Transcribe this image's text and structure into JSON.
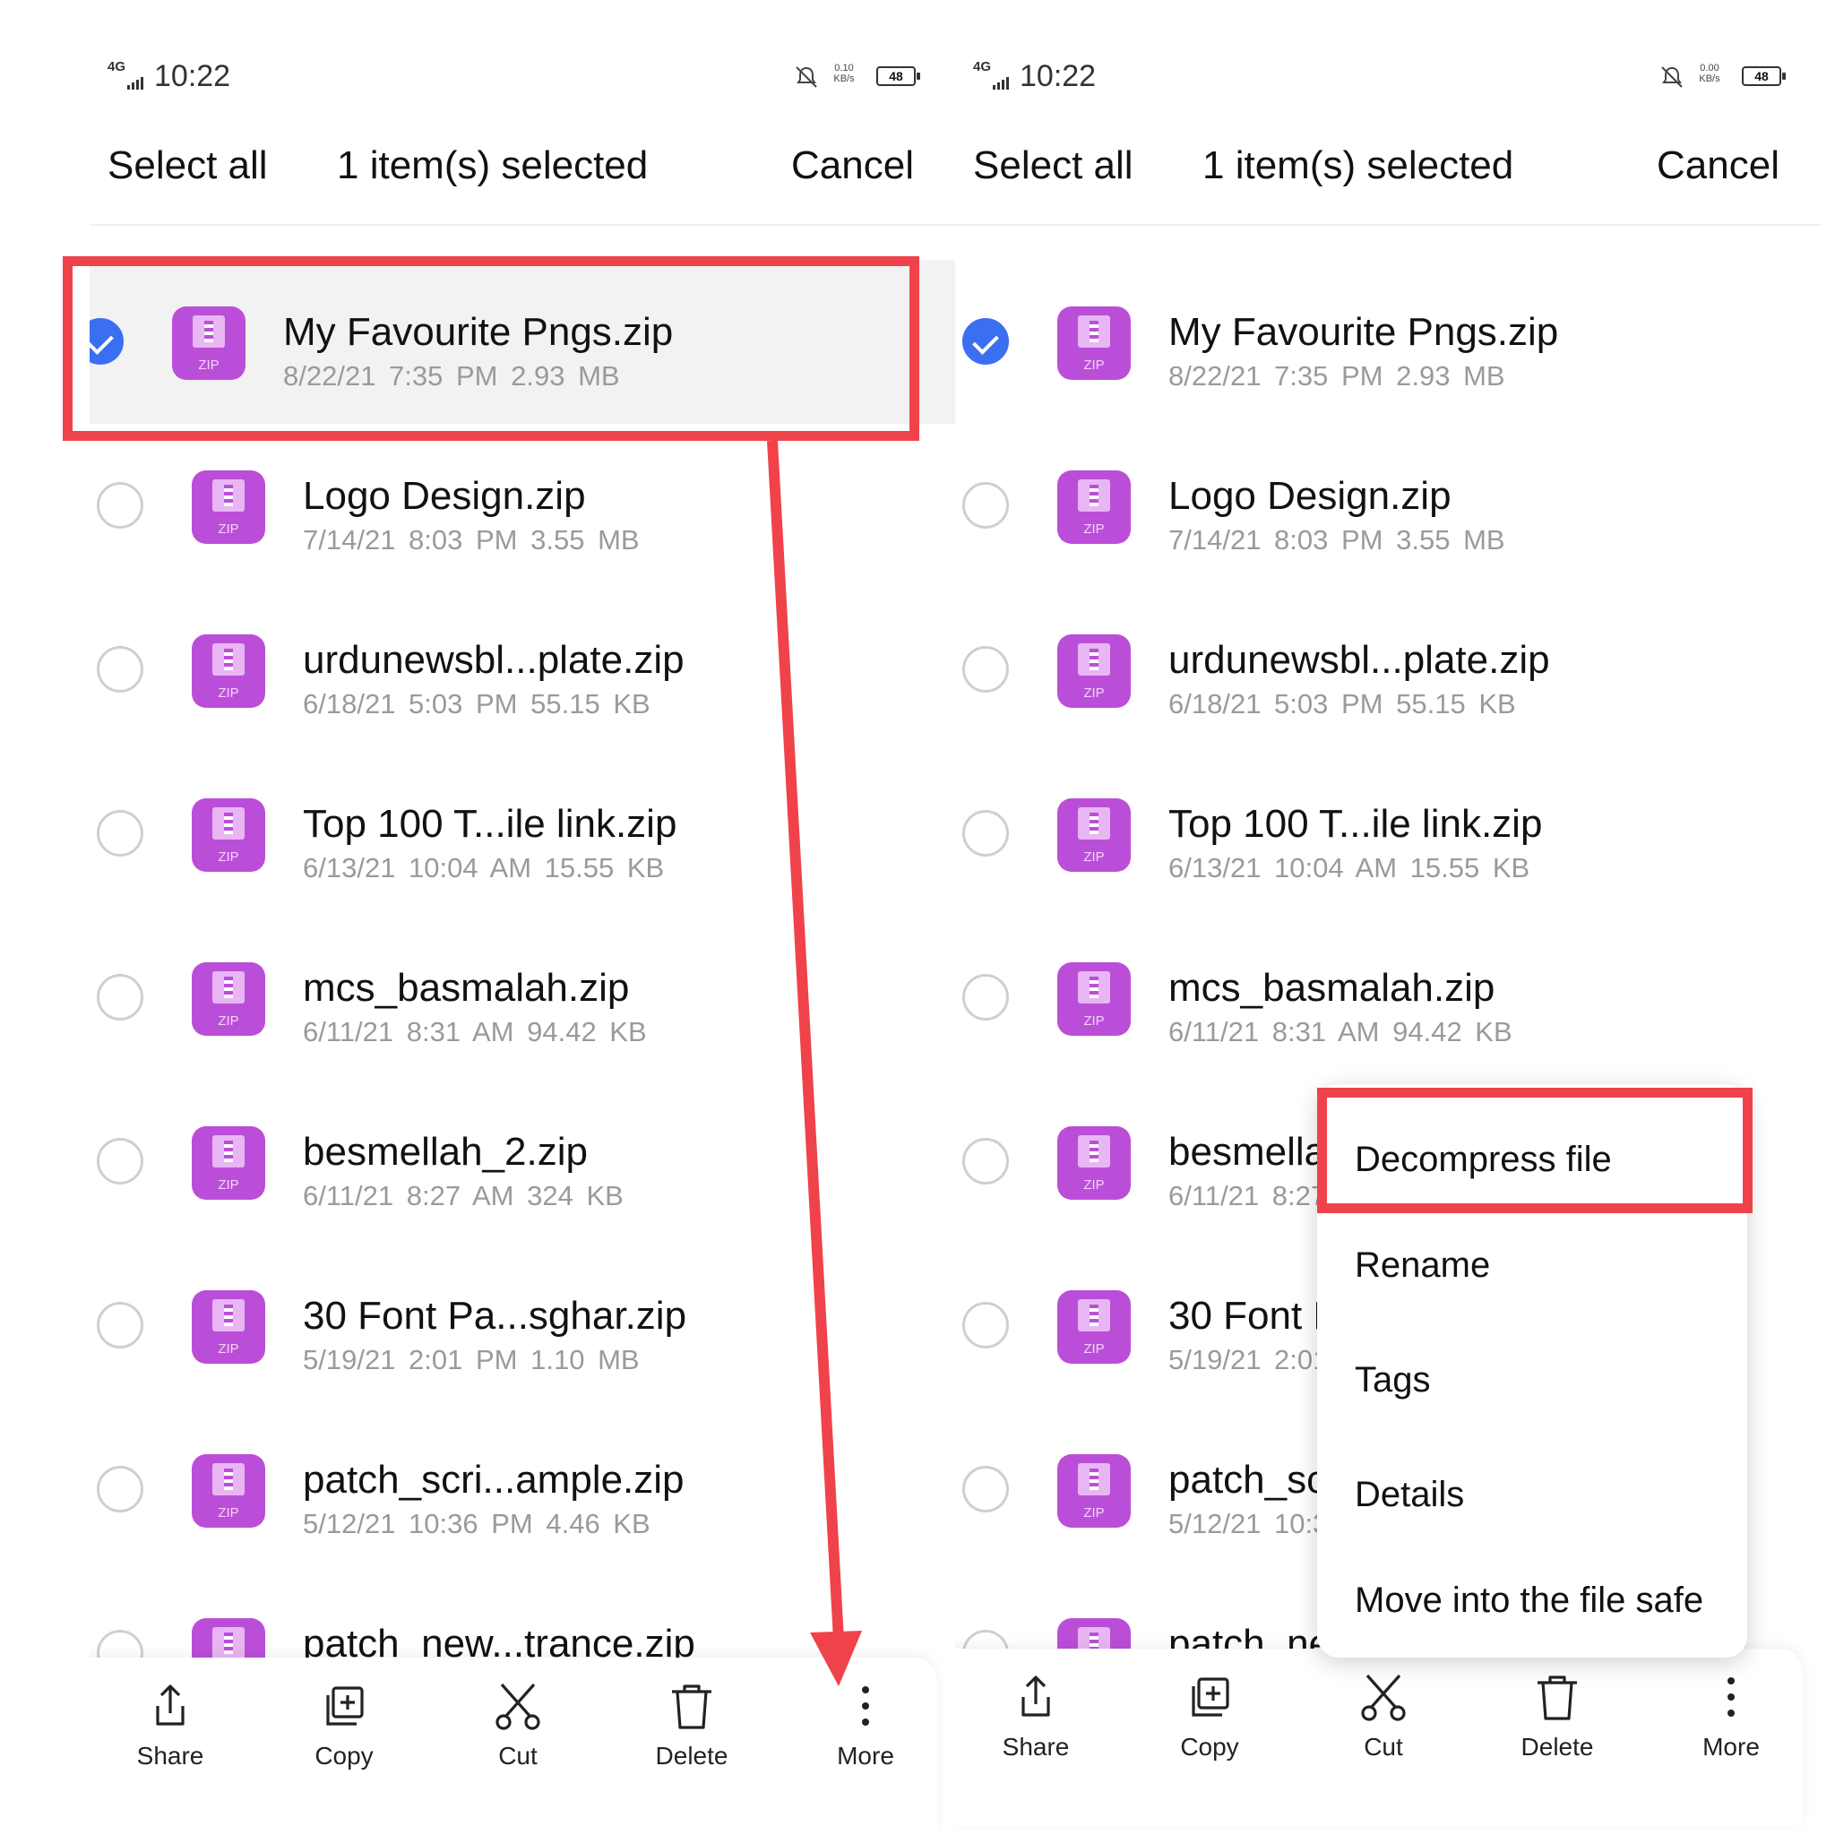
{
  "status_bar": {
    "network": "4G",
    "time": "10:22",
    "battery": "48",
    "speed_left": "0.10",
    "speed_right": "0.00",
    "speed_unit": "KB/s"
  },
  "header": {
    "select_all": "Select all",
    "title": "1 item(s) selected",
    "cancel": "Cancel"
  },
  "files": [
    {
      "name": "My Favourite Pngs.zip",
      "date": "8/22/21 7:35 PM",
      "size": "2.93 MB",
      "selected": true
    },
    {
      "name": "Logo Design.zip",
      "date": "7/14/21 8:03 PM",
      "size": "3.55 MB",
      "selected": false
    },
    {
      "name": "urdunewsbl...plate.zip",
      "date": "6/18/21 5:03 PM",
      "size": "55.15 KB",
      "selected": false
    },
    {
      "name": "Top 100 T...ile link.zip",
      "date": "6/13/21 10:04 AM",
      "size": "15.55 KB",
      "selected": false
    },
    {
      "name": "mcs_basmalah.zip",
      "date": "6/11/21 8:31 AM",
      "size": "94.42 KB",
      "selected": false
    },
    {
      "name": "besmellah_2.zip",
      "date": "6/11/21 8:27 AM",
      "size": "324 KB",
      "selected": false
    },
    {
      "name": "30 Font Pa...sghar.zip",
      "date": "5/19/21 2:01 PM",
      "size": "1.10 MB",
      "selected": false
    },
    {
      "name": "patch_scri...ample.zip",
      "date": "5/12/21 10:36 PM",
      "size": "4.46 KB",
      "selected": false
    },
    {
      "name": "patch_new...trance.zip",
      "date": "",
      "size": "",
      "selected": false
    }
  ],
  "zip_label": "ZIP",
  "toolbar": {
    "share": "Share",
    "copy": "Copy",
    "cut": "Cut",
    "delete": "Delete",
    "more": "More"
  },
  "more_menu": {
    "items": [
      "Decompress file",
      "Rename",
      "Tags",
      "Details",
      "Move into the file safe"
    ]
  },
  "annotations": {
    "color": "#f0424a",
    "description": [
      "selected-file-highlight",
      "arrow-to-more",
      "decompress-highlight"
    ]
  },
  "icons": [
    "signal-icon",
    "mute-bell-icon",
    "battery-icon",
    "zip-file-icon",
    "check-icon",
    "share-icon",
    "copy-icon",
    "cut-icon",
    "delete-icon",
    "more-icon"
  ],
  "colors": {
    "accent": "#3a6ff2",
    "zip": "#bb4ed8",
    "highlight": "#f0424a"
  }
}
